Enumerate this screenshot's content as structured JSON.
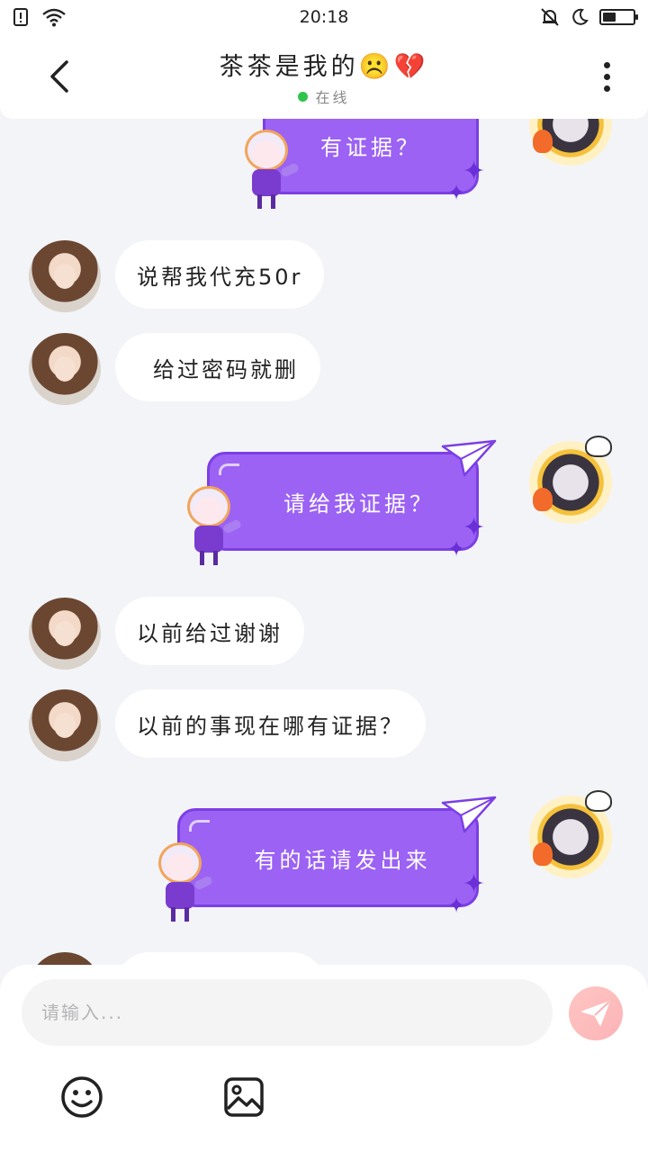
{
  "status_bar": {
    "time": "20:18",
    "battery_level": 0.45
  },
  "header": {
    "title": "茶茶是我的",
    "title_emojis": "☹️💔",
    "status": "在线",
    "status_color": "#2fc44a"
  },
  "messages": [
    {
      "side": "right",
      "text": "有证据？"
    },
    {
      "side": "left",
      "text": "说帮我代充50r"
    },
    {
      "side": "left",
      "text": "给过密码就删"
    },
    {
      "side": "right",
      "text": "请给我证据？"
    },
    {
      "side": "left",
      "text": "以前给过谢谢"
    },
    {
      "side": "left",
      "text": "以前的事现在哪有证据？"
    },
    {
      "side": "right",
      "text": "有的话请发出来"
    }
  ],
  "composer": {
    "placeholder": "请输入..."
  },
  "colors": {
    "accent_purple": "#9b62f4",
    "bubble_border": "#7b3fe4",
    "send_pink": "#fbb3b7"
  }
}
